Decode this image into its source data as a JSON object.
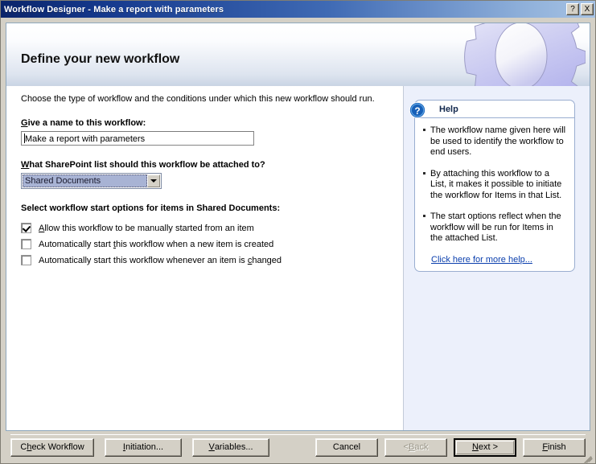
{
  "window": {
    "title": "Workflow Designer - Make a report with parameters",
    "help_button": "?",
    "close_button": "X",
    "accent_titlebar": "#0a246a",
    "face_color": "#d4d0c6"
  },
  "banner": {
    "heading": "Define your new workflow",
    "gear_icon": "gear-icon",
    "gear_color": "#bdbdf0"
  },
  "main": {
    "intro": "Choose the type of workflow and the conditions under which this new workflow should run.",
    "name_label_prefix": "G",
    "name_label_rest": "ive a name to this workflow:",
    "name_value": "Make a report with parameters",
    "list_label_prefix": "W",
    "list_label_rest": "hat SharePoint list should this workflow be attached to?",
    "list_selected": "Shared Documents",
    "list_options": [
      "Shared Documents"
    ],
    "start_options_heading": "Select workflow start options for items in Shared Documents:",
    "checkboxes": [
      {
        "checked": true,
        "pre": "",
        "key": "A",
        "post": "llow this workflow to be manually started from an item"
      },
      {
        "checked": false,
        "pre": "Automatically start ",
        "key": "t",
        "post": "his workflow when a new item is created"
      },
      {
        "checked": false,
        "pre": "Automatically start this workflow whenever an item is ",
        "key": "c",
        "post": "hanged"
      }
    ]
  },
  "help": {
    "icon": "help-question-icon",
    "title": "Help",
    "items": [
      "The workflow name given here will be used to identify the workflow to end users.",
      "By attaching this workflow to a List, it makes it possible to initiate the workflow for Items in that List.",
      "The start options reflect when the workflow will be run for Items in the attached List."
    ],
    "link": "Click here for more help...",
    "link_color": "#0b3fad",
    "panel_bg": "#ecf0fb"
  },
  "buttons": {
    "check_workflow": {
      "pre": "C",
      "key": "h",
      "post": "eck Workflow"
    },
    "initiation": {
      "pre": "",
      "key": "I",
      "post": "nitiation..."
    },
    "variables": {
      "pre": "",
      "key": "V",
      "post": "ariables..."
    },
    "cancel": {
      "pre": "Cancel",
      "key": "",
      "post": ""
    },
    "back": {
      "pre": "< ",
      "key": "B",
      "post": "ack"
    },
    "next": {
      "pre": "",
      "key": "N",
      "post": "ext >"
    },
    "finish": {
      "pre": "",
      "key": "F",
      "post": "inish"
    }
  }
}
